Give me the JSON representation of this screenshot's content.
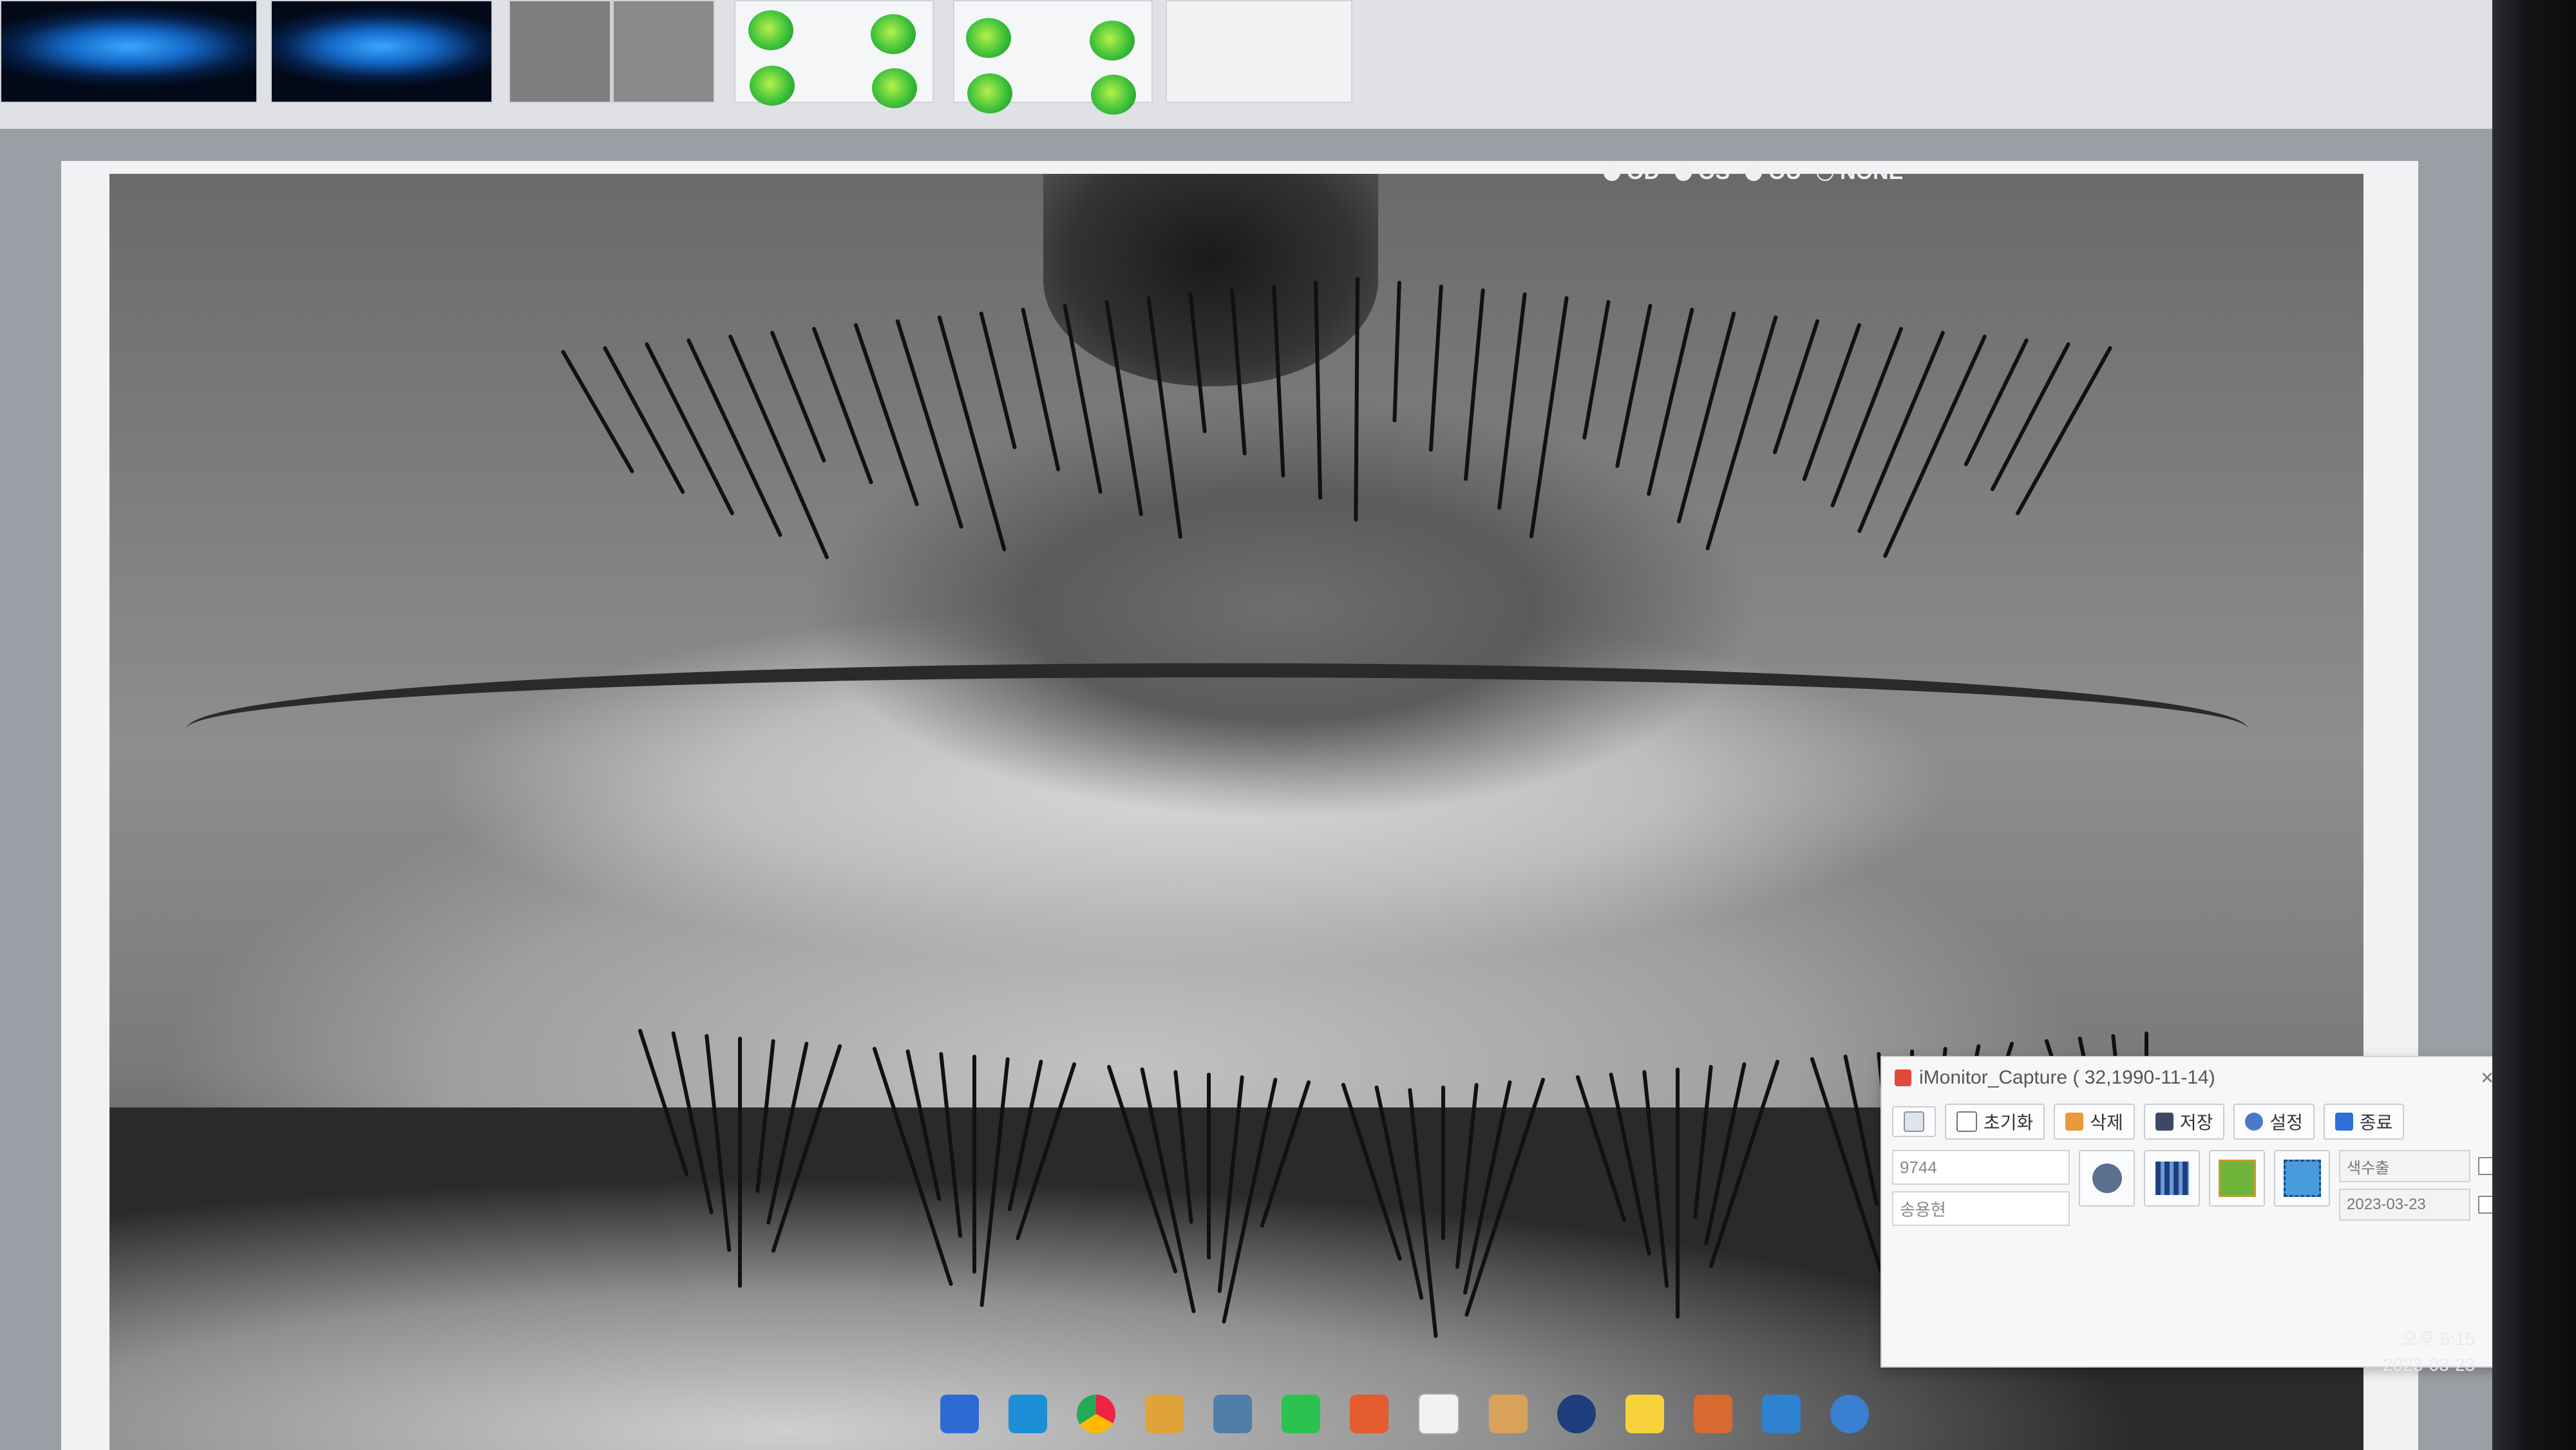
{
  "thumbnails": [
    {
      "label": "",
      "kind": "eye-blue"
    },
    {
      "label": "",
      "kind": "eye-blue"
    },
    {
      "label": "",
      "kind": "eye-gray"
    },
    {
      "label": "",
      "kind": "map"
    },
    {
      "label": "",
      "kind": "map"
    },
    {
      "label": "",
      "kind": "chart"
    }
  ],
  "eye_select": {
    "options": [
      "OD",
      "OS",
      "OU",
      "NONE"
    ],
    "selected": "NONE"
  },
  "capture_dialog": {
    "title": "iMonitor_Capture ( 32,1990-11-14)",
    "close_glyph": "×",
    "toolbar": {
      "reset_label": "초기화",
      "delete_label": "삭제",
      "save_label": "저장",
      "settings_label": "설정",
      "exit_label": "종료"
    },
    "fields": {
      "patient_id": "9744",
      "patient_name": "송용현"
    },
    "combo_value": "색수출",
    "date_value": "2023-03-23"
  },
  "taskbar": {
    "apps": [
      "explorer",
      "edge",
      "chrome",
      "files",
      "calculator",
      "line",
      "app-red",
      "clipboard",
      "ruler",
      "eye-app",
      "kakaotalk",
      "gallery",
      "paint",
      "dicom"
    ]
  },
  "system_tray": {
    "time": "오후 6:15",
    "date": "2023-03-23"
  },
  "colors": {
    "accent_blue": "#1468c7",
    "map_green": "#3fc23a",
    "dialog_bg": "#f7f7f8"
  }
}
